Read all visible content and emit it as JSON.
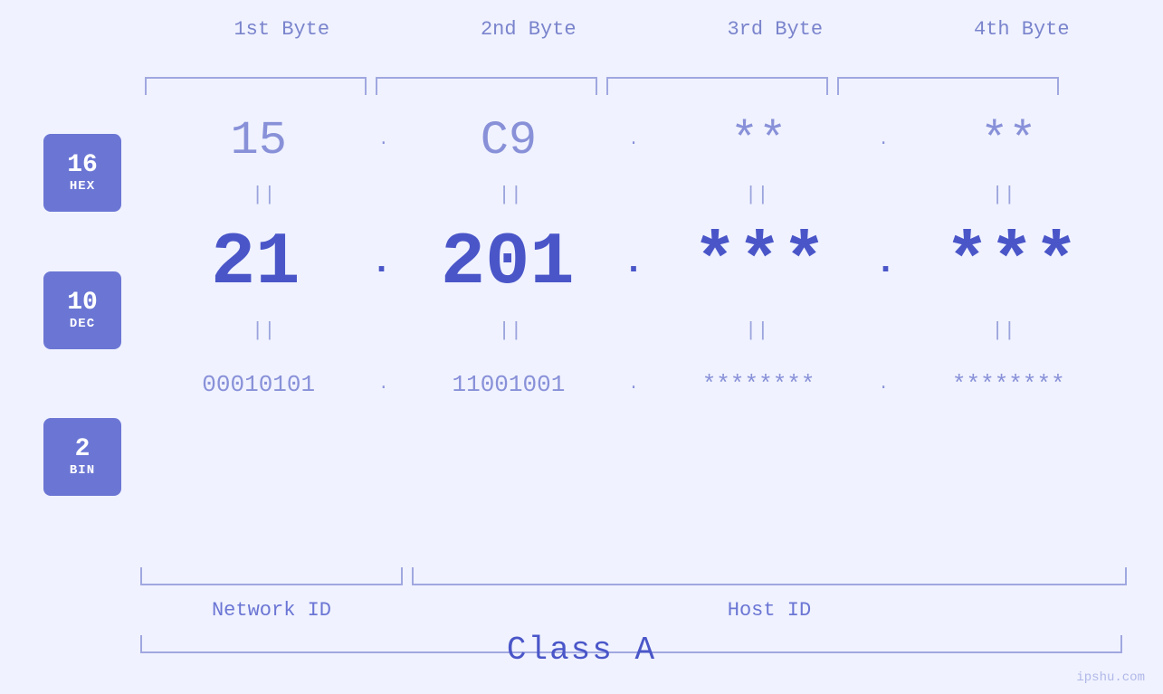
{
  "badges": {
    "hex": {
      "number": "16",
      "label": "HEX"
    },
    "dec": {
      "number": "10",
      "label": "DEC"
    },
    "bin": {
      "number": "2",
      "label": "BIN"
    }
  },
  "headers": [
    "1st Byte",
    "2nd Byte",
    "3rd Byte",
    "4th Byte"
  ],
  "rows": {
    "hex": [
      "15",
      "C9",
      "**",
      "**"
    ],
    "dec": [
      "21",
      "201",
      "***",
      "***"
    ],
    "bin": [
      "00010101",
      "11001001",
      "********",
      "********"
    ]
  },
  "labels": {
    "network_id": "Network ID",
    "host_id": "Host ID",
    "class": "Class A"
  },
  "watermark": "ipshu.com"
}
